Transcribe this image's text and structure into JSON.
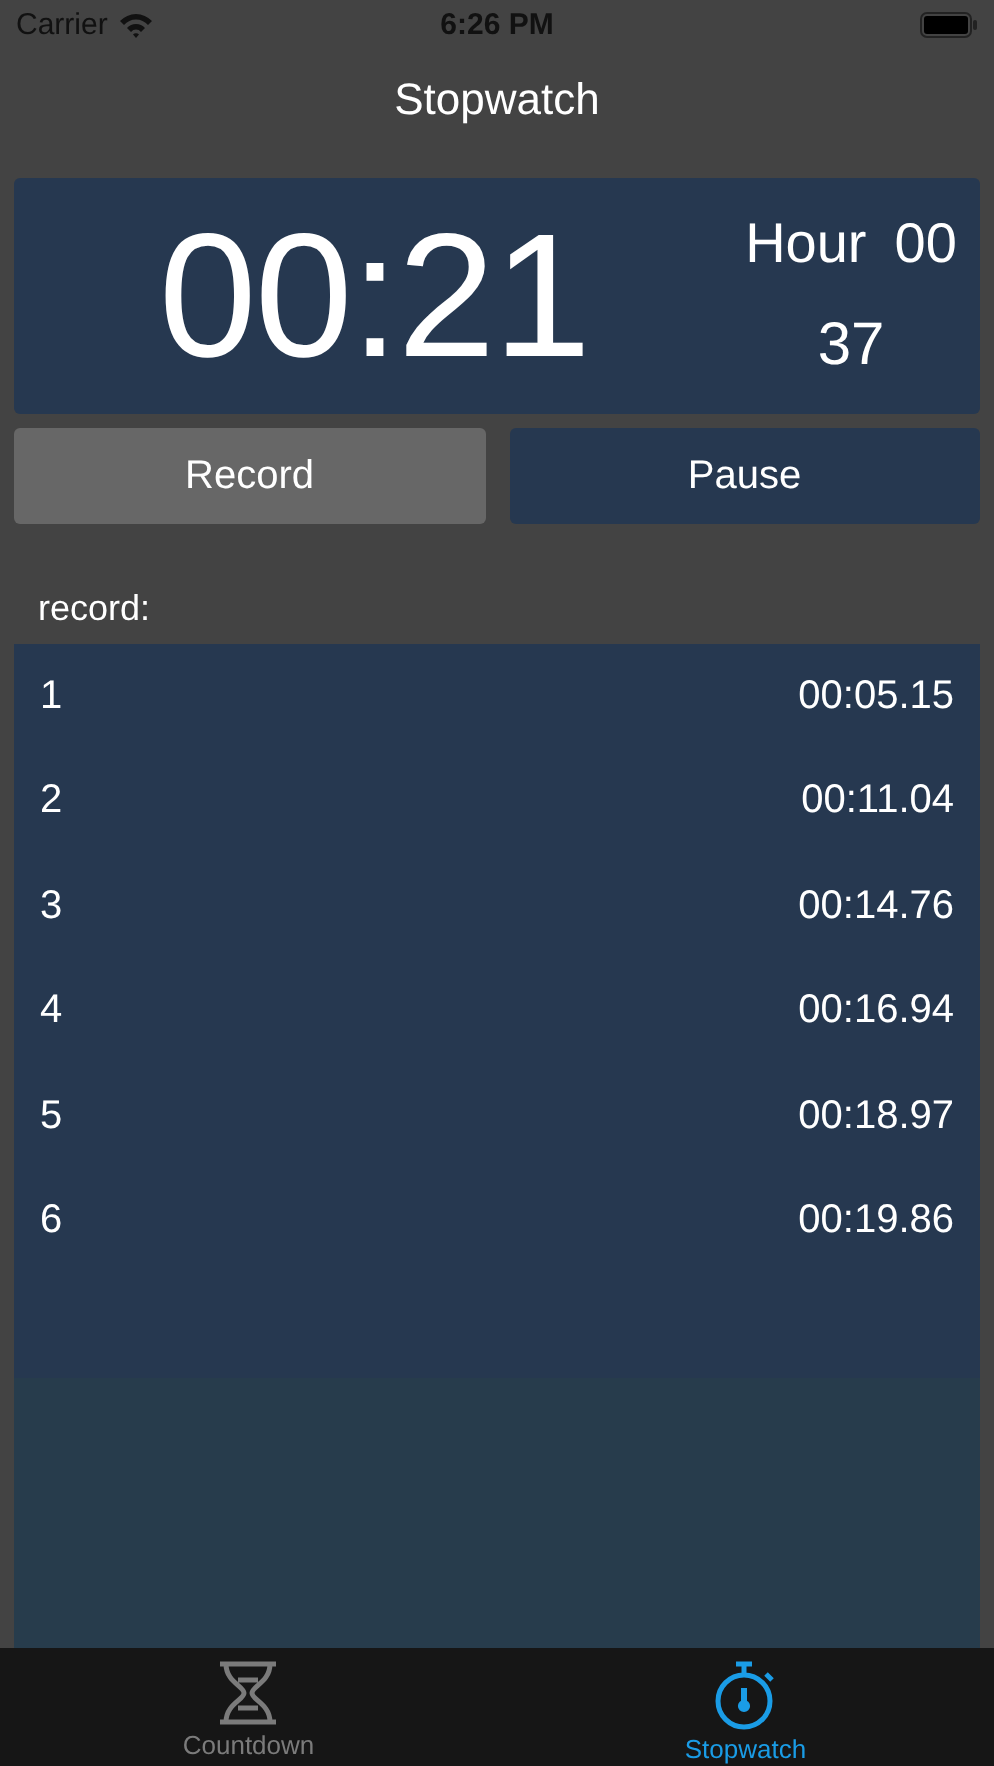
{
  "status_bar": {
    "carrier": "Carrier",
    "time": "6:26 PM"
  },
  "nav": {
    "title": "Stopwatch"
  },
  "timer": {
    "main": "00:21",
    "hour_label": "Hour",
    "hour_value": "00",
    "fraction": "37"
  },
  "buttons": [
    {
      "label": "Record",
      "kind": "secondary"
    },
    {
      "label": "Pause",
      "kind": "primary"
    }
  ],
  "record_label": "record:",
  "laps": [
    {
      "index": "1",
      "time": "00:05.15"
    },
    {
      "index": "2",
      "time": "00:11.04"
    },
    {
      "index": "3",
      "time": "00:14.76"
    },
    {
      "index": "4",
      "time": "00:16.94"
    },
    {
      "index": "5",
      "time": "00:18.97"
    },
    {
      "index": "6",
      "time": "00:19.86"
    }
  ],
  "tabs": [
    {
      "label": "Countdown",
      "kind": "hourglass",
      "selected": false
    },
    {
      "label": "Stopwatch",
      "kind": "stopwatch",
      "selected": true
    }
  ]
}
